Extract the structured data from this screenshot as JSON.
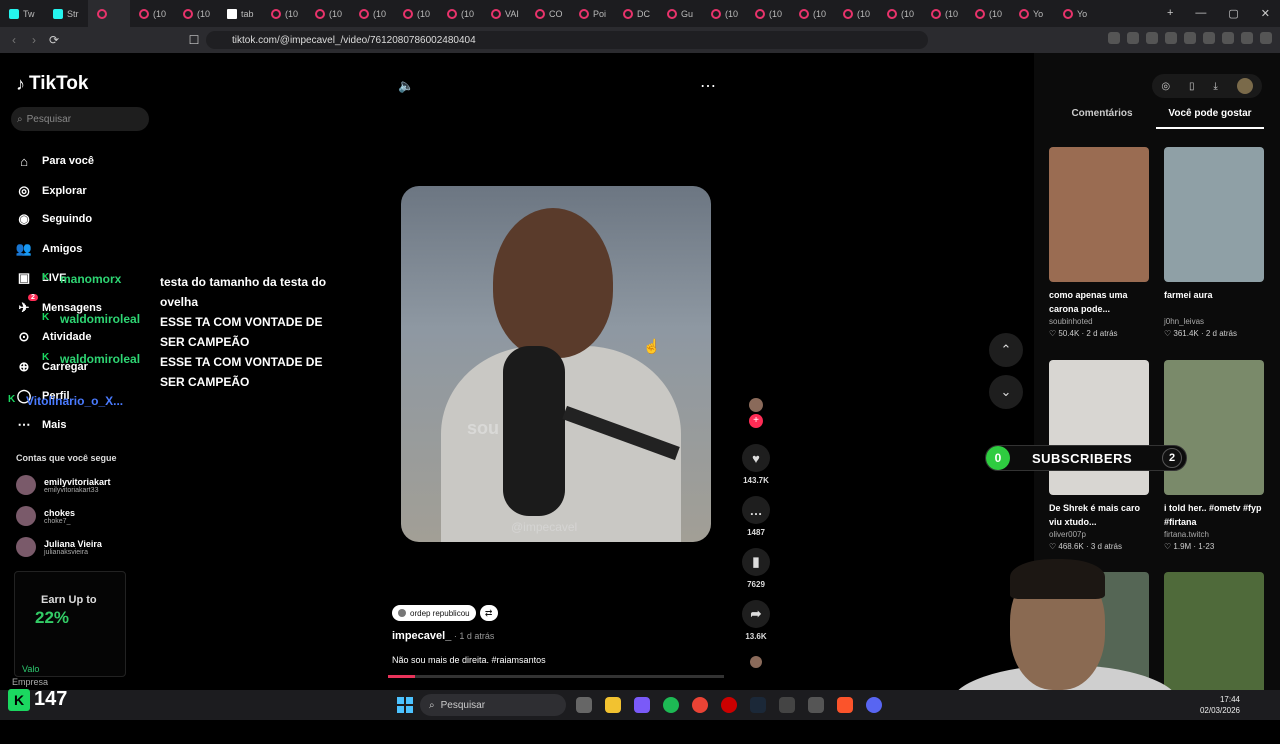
{
  "browser": {
    "tabs": [
      {
        "label": "Tw",
        "icon": "twitch"
      },
      {
        "label": "Str",
        "icon": "kick"
      },
      {
        "label": "",
        "icon": "audio",
        "active": true
      },
      {
        "label": "(10",
        "icon": "youtube"
      },
      {
        "label": "(10",
        "icon": "youtube"
      },
      {
        "label": "tab",
        "icon": "news"
      },
      {
        "label": "(10",
        "icon": "youtube"
      },
      {
        "label": "(10",
        "icon": "youtube"
      },
      {
        "label": "(10",
        "icon": "youtube"
      },
      {
        "label": "(10",
        "icon": "youtube"
      },
      {
        "label": "(10",
        "icon": "youtube"
      },
      {
        "label": "VAI",
        "icon": "youtube"
      },
      {
        "label": "CO",
        "icon": "youtube"
      },
      {
        "label": "Poi",
        "icon": "youtube"
      },
      {
        "label": "DC",
        "icon": "youtube"
      },
      {
        "label": "Gu",
        "icon": "youtube"
      },
      {
        "label": "(10",
        "icon": "youtube"
      },
      {
        "label": "(10",
        "icon": "youtube"
      },
      {
        "label": "(10",
        "icon": "youtube"
      },
      {
        "label": "(10",
        "icon": "youtube"
      },
      {
        "label": "(10",
        "icon": "youtube"
      },
      {
        "label": "(10",
        "icon": "youtube"
      },
      {
        "label": "(10",
        "icon": "youtube"
      },
      {
        "label": "Yo",
        "icon": "youtube"
      },
      {
        "label": "Yo",
        "icon": "youtube"
      }
    ],
    "url": "tiktok.com/@impecavel_/video/7612080786002480404"
  },
  "sidebar": {
    "logo": "TikTok",
    "search_placeholder": "Pesquisar",
    "nav": [
      {
        "label": "Para você",
        "icon": "home-icon"
      },
      {
        "label": "Explorar",
        "icon": "compass-icon"
      },
      {
        "label": "Seguindo",
        "icon": "following-icon"
      },
      {
        "label": "Amigos",
        "icon": "friends-icon"
      },
      {
        "label": "LIVE",
        "icon": "live-icon"
      },
      {
        "label": "Mensagens",
        "icon": "messages-icon",
        "badge": "2"
      },
      {
        "label": "Atividade",
        "icon": "activity-icon"
      },
      {
        "label": "Carregar",
        "icon": "upload-icon"
      },
      {
        "label": "Perfil",
        "icon": "profile-icon"
      },
      {
        "label": "Mais",
        "icon": "more-icon"
      }
    ],
    "follows_title": "Contas que você segue",
    "accounts": [
      {
        "name": "emilyvitoriakart",
        "handle": "emilyvitoriakart33"
      },
      {
        "name": "chokes",
        "handle": "choke7_"
      },
      {
        "name": "Juliana Vieira",
        "handle": "julianaksvieira"
      }
    ],
    "promo": {
      "title": "Earn Up to",
      "value": "22%"
    },
    "footer": "Empresa"
  },
  "chat": [
    {
      "user": "manomorx",
      "msg": "testa do tamanho da testa do ovelha"
    },
    {
      "user": "waldomiroleal",
      "msg": "ESSE TA COM VONTADE DE SER CAMPEÃO"
    },
    {
      "user": "waldomiroleal",
      "msg": "ESSE TA COM VONTADE DE SER CAMPEÃO"
    },
    {
      "user": "Vitolinario_o_X...",
      "msg": ""
    }
  ],
  "video": {
    "caption_overlay": "sou",
    "watermark": "@impecavel",
    "likes": "143.7K",
    "comments": "1487",
    "saves": "7629",
    "shares": "13.6K",
    "repost_label": "ordep republicou",
    "author": "impecavel_",
    "when": " · 1 d atrás",
    "description": "Não sou mais de direita. #raiamsantos",
    "progress": 0.08
  },
  "right": {
    "tabs": [
      "Comentários",
      "Você pode gostar"
    ],
    "cards": [
      {
        "title": "como apenas uma carona pode...",
        "user": "soubinhoted",
        "stats": "♡ 50.4K · 2 d atrás",
        "color": "#9a6c52"
      },
      {
        "title": "farmei aura",
        "user": "j0hn_leivas",
        "stats": "♡ 361.4K · 2 d atrás",
        "color": "#8fa0a6"
      },
      {
        "title": "De Shrek é mais caro viu xtudo...",
        "user": "oliver007p",
        "stats": "♡ 468.6K · 3 d atrás",
        "color": "#d8d6d2"
      },
      {
        "title": "i told her.. #ometv #fyp #firtana",
        "user": "firtana.twitch",
        "stats": "♡ 1.9M · 1-23",
        "color": "#7a8a6a"
      },
      {
        "title": "",
        "user": "",
        "stats": "",
        "color": "#556655"
      },
      {
        "title": "",
        "user": "",
        "stats": "",
        "color": "#4f6a3a"
      }
    ]
  },
  "overlay": {
    "sub_left": "0",
    "sub_label": "SUBSCRIBERS",
    "sub_right": "2",
    "kick_count": "147",
    "kick_sub": "Valo"
  },
  "taskbar": {
    "search": "Pesquisar",
    "time": "17:44",
    "date": "02/03/2026"
  }
}
